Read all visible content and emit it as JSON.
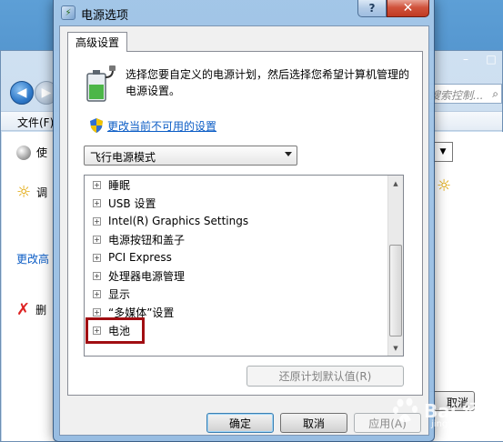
{
  "background_window": {
    "search_placeholder": "搜索控制...",
    "menu_file": "文件(F)",
    "row1_text": "使",
    "row2_text": "调",
    "link1_text": "更改高",
    "row3_text": "删",
    "cancel_partial": "取消",
    "minimize": "–",
    "maximize": "□",
    "close": "✕"
  },
  "dialog": {
    "title": "电源选项",
    "help": "?",
    "close": "✕",
    "tab_label": "高级设置",
    "intro_text": "选择您要自定义的电源计划，然后选择您希望计算机管理的电源设置。",
    "change_link": "更改当前不可用的设置",
    "plan_selected": "飞行电源模式",
    "tree_items": [
      {
        "label": "睡眠",
        "expander": "+"
      },
      {
        "label": "USB 设置",
        "expander": "+"
      },
      {
        "label": "Intel(R) Graphics Settings",
        "expander": "+"
      },
      {
        "label": "电源按钮和盖子",
        "expander": "+"
      },
      {
        "label": "PCI Express",
        "expander": "+"
      },
      {
        "label": "处理器电源管理",
        "expander": "+"
      },
      {
        "label": "显示",
        "expander": "+"
      },
      {
        "label": "“多媒体”设置",
        "expander": "+"
      },
      {
        "label": "电池",
        "expander": "+"
      }
    ],
    "restore_button": "还原计划默认值(R)",
    "ok_button": "确定",
    "cancel_button": "取消",
    "apply_button": "应用(A)"
  },
  "watermark": {
    "text": "Bai 经验",
    "sub": "jingyan.baidu.com"
  },
  "colors": {
    "highlight": "#a10e12",
    "link": "#0b5cc5"
  }
}
